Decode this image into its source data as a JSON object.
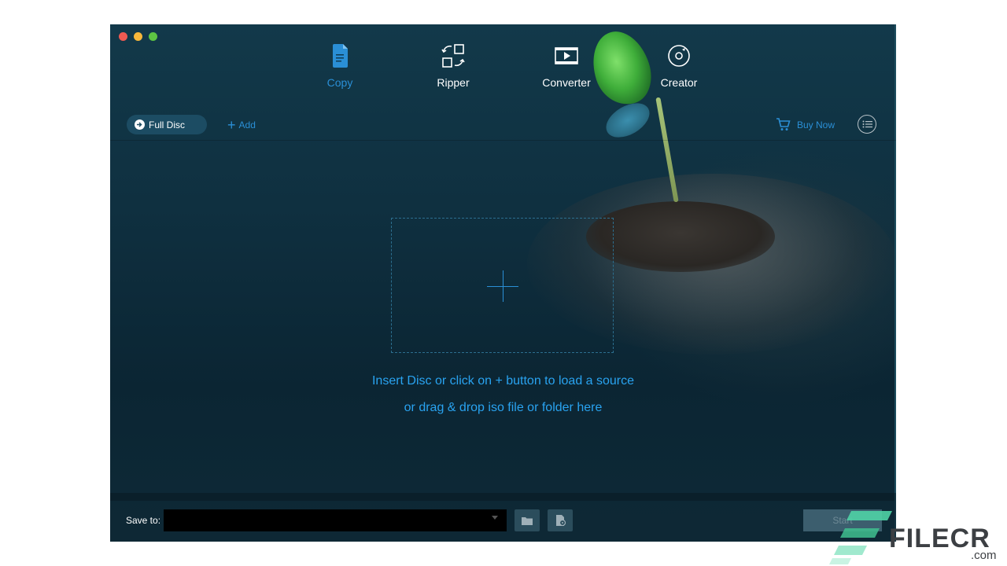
{
  "window": {
    "traffic_lights": [
      "close",
      "minimize",
      "zoom"
    ]
  },
  "nav": {
    "items": [
      {
        "label": "Copy",
        "icon": "copy-icon",
        "active": true
      },
      {
        "label": "Ripper",
        "icon": "ripper-icon",
        "active": false
      },
      {
        "label": "Converter",
        "icon": "converter-icon",
        "active": false
      },
      {
        "label": "Creator",
        "icon": "creator-icon",
        "active": false
      }
    ],
    "active_color": "#2a8fd6"
  },
  "toolbar": {
    "full_disc_label": "Full Disc",
    "add_label": "Add",
    "buy_now_label": "Buy Now",
    "menu_icon": "list-menu-icon"
  },
  "main": {
    "hint_line1": "Insert Disc or click on + button to load a source",
    "hint_line2": "or drag & drop iso file or folder here",
    "hint_color": "#29a3f0"
  },
  "bottom": {
    "save_to_label": "Save to:",
    "save_path_value": "",
    "start_label": "Start"
  },
  "watermark": {
    "brand": "FILECR",
    "domain": ".com",
    "brand_color": "#3c3f43"
  }
}
